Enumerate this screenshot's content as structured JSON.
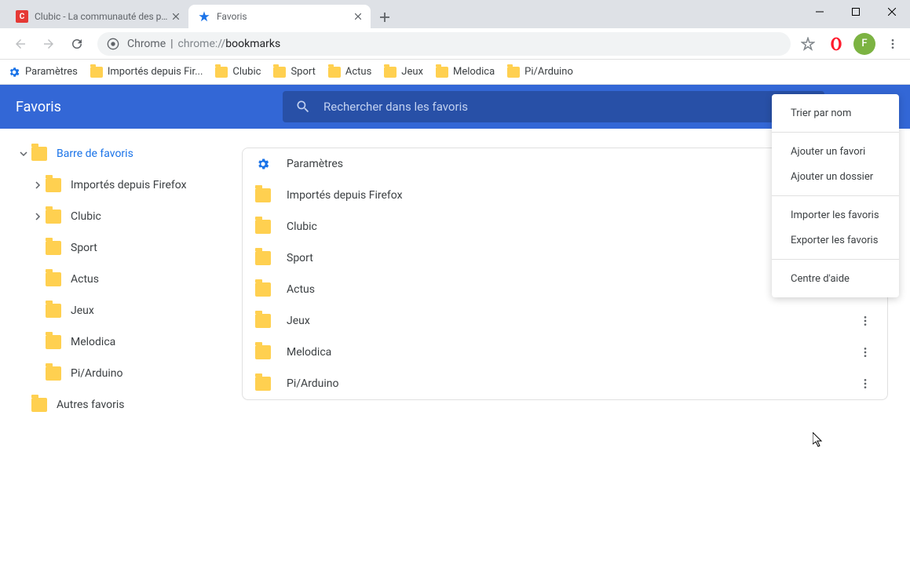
{
  "window": {
    "min": "−",
    "max": "☐",
    "close": "✕"
  },
  "tabs": [
    {
      "title": "Clubic - La communauté des pas",
      "active": false,
      "favicon": "clubic"
    },
    {
      "title": "Favoris",
      "active": true,
      "favicon": "star"
    }
  ],
  "omnibox": {
    "chrome_label": "Chrome",
    "url_prefix": "chrome://",
    "url_path": "bookmarks"
  },
  "avatar_letter": "F",
  "bookmarks_bar": [
    {
      "label": "Paramètres",
      "icon": "gear"
    },
    {
      "label": "Importés depuis Fir...",
      "icon": "folder"
    },
    {
      "label": "Clubic",
      "icon": "folder"
    },
    {
      "label": "Sport",
      "icon": "folder"
    },
    {
      "label": "Actus",
      "icon": "folder"
    },
    {
      "label": "Jeux",
      "icon": "folder"
    },
    {
      "label": "Melodica",
      "icon": "folder"
    },
    {
      "label": "Pi/Arduino",
      "icon": "folder"
    }
  ],
  "app_header_title": "Favoris",
  "search_placeholder": "Rechercher dans les favoris",
  "sidebar": {
    "items": [
      {
        "label": "Barre de favoris",
        "level": 0,
        "caret": "down",
        "selected": true
      },
      {
        "label": "Importés depuis Firefox",
        "level": 1,
        "caret": "right",
        "selected": false
      },
      {
        "label": "Clubic",
        "level": 1,
        "caret": "right",
        "selected": false
      },
      {
        "label": "Sport",
        "level": 1,
        "caret": "none",
        "selected": false
      },
      {
        "label": "Actus",
        "level": 1,
        "caret": "none",
        "selected": false
      },
      {
        "label": "Jeux",
        "level": 1,
        "caret": "none",
        "selected": false
      },
      {
        "label": "Melodica",
        "level": 1,
        "caret": "none",
        "selected": false
      },
      {
        "label": "Pi/Arduino",
        "level": 1,
        "caret": "none",
        "selected": false
      },
      {
        "label": "Autres favoris",
        "level": 0,
        "caret": "noarrow",
        "selected": false
      }
    ]
  },
  "list": [
    {
      "label": "Paramètres",
      "icon": "gear",
      "menu": false
    },
    {
      "label": "Importés depuis Firefox",
      "icon": "folder",
      "menu": false
    },
    {
      "label": "Clubic",
      "icon": "folder",
      "menu": false
    },
    {
      "label": "Sport",
      "icon": "folder",
      "menu": false
    },
    {
      "label": "Actus",
      "icon": "folder",
      "menu": false
    },
    {
      "label": "Jeux",
      "icon": "folder",
      "menu": true
    },
    {
      "label": "Melodica",
      "icon": "folder",
      "menu": true
    },
    {
      "label": "Pi/Arduino",
      "icon": "folder",
      "menu": true
    }
  ],
  "dropdown": [
    {
      "type": "item",
      "label": "Trier par nom"
    },
    {
      "type": "divider"
    },
    {
      "type": "item",
      "label": "Ajouter un favori"
    },
    {
      "type": "item",
      "label": "Ajouter un dossier"
    },
    {
      "type": "divider"
    },
    {
      "type": "item",
      "label": "Importer les favoris"
    },
    {
      "type": "item",
      "label": "Exporter les favoris"
    },
    {
      "type": "divider"
    },
    {
      "type": "item",
      "label": "Centre d'aide"
    }
  ]
}
